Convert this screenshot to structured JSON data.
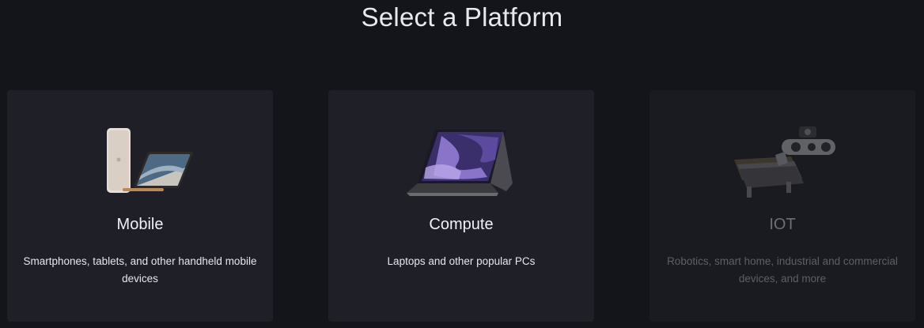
{
  "page": {
    "title": "Select a Platform"
  },
  "platforms": [
    {
      "title": "Mobile",
      "description": "Smartphones, tablets, and other handheld mobile devices",
      "image": "phone-and-tablet-image",
      "enabled": true
    },
    {
      "title": "Compute",
      "description": "Laptops and other popular PCs",
      "image": "laptop-image",
      "enabled": true
    },
    {
      "title": "IOT",
      "description": "Robotics, smart home, industrial and commercial devices, and more",
      "image": "robotics-board-image",
      "enabled": false
    }
  ],
  "colors": {
    "background": "#14151b",
    "card": "#1e1f27",
    "text": "#f1f2f6",
    "disabled_text": "#6d6e76"
  }
}
